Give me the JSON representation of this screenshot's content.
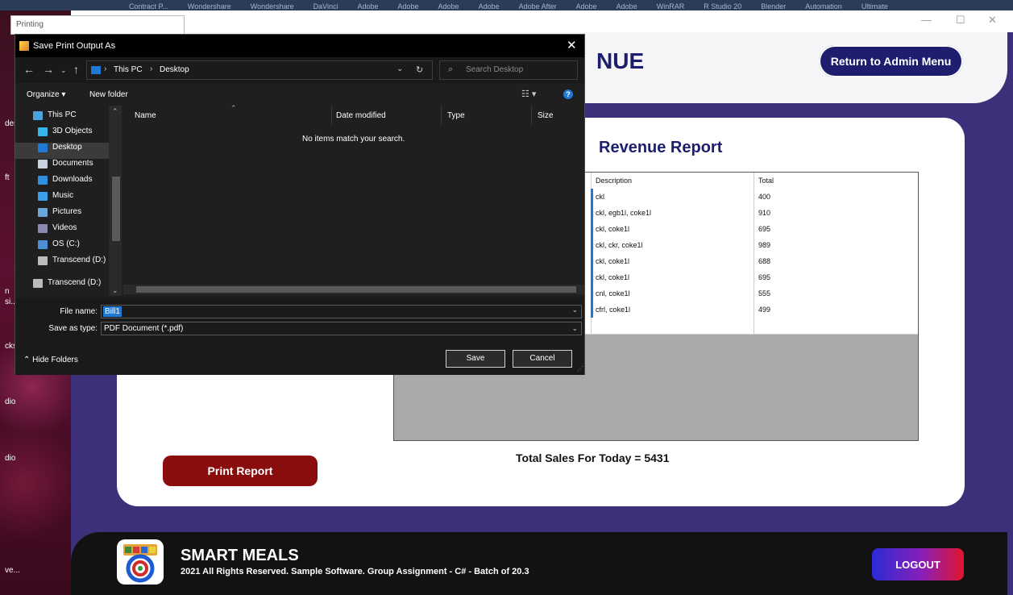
{
  "taskbar": {
    "items": [
      "Contract P...",
      "Wondershare",
      "Wondershare",
      "DaVinci",
      "Adobe",
      "Adobe",
      "Adobe",
      "Adobe",
      "Adobe After",
      "Adobe",
      "Adobe",
      "WinRAR",
      "R Studio 20",
      "Blender",
      "Automation",
      "Ultimate"
    ]
  },
  "desktop": {
    "labels": [
      "der",
      "ft",
      "n",
      "si...",
      "cks",
      "dio",
      "dio",
      "ve..."
    ]
  },
  "printing_window": {
    "title": "Printing"
  },
  "app": {
    "header_title": "NUE",
    "return_button": "Return to Admin Menu",
    "report_title": "Revenue Report",
    "grid": {
      "columns": [
        "Description",
        "Total"
      ],
      "rows": [
        {
          "description": "ckl",
          "total": "400"
        },
        {
          "description": "ckl, egb1l, coke1l",
          "total": "910"
        },
        {
          "description": "ckl, coke1l",
          "total": "695"
        },
        {
          "description": "ckl, ckr, coke1l",
          "total": "989"
        },
        {
          "description": "ckl, coke1l",
          "total": "688"
        },
        {
          "description": "ckl, coke1l",
          "total": "695"
        },
        {
          "description": "cnl, coke1l",
          "total": "555"
        },
        {
          "description": "cfrl, coke1l",
          "total": "499"
        },
        {
          "description": "",
          "total": ""
        }
      ]
    },
    "total_sales": "Total Sales For Today = 5431",
    "print_button": "Print Report",
    "footer": {
      "brand": "SMART MEALS",
      "copyright": "2021 All Rights Reserved.  Sample Software. Group Assignment - C# - Batch of 20.3",
      "logout_button": "LOGOUT"
    }
  },
  "save_dialog": {
    "title": "Save Print Output As",
    "breadcrumb": [
      "This PC",
      "Desktop"
    ],
    "search_placeholder": "Search Desktop",
    "organize": "Organize ▾",
    "new_folder": "New folder",
    "nav_tree": [
      "This PC",
      "3D Objects",
      "Desktop",
      "Documents",
      "Downloads",
      "Music",
      "Pictures",
      "Videos",
      "OS (C:)",
      "Transcend (D:)",
      "Transcend (D:)"
    ],
    "nav_tree_selected": "Desktop",
    "columns": [
      "Name",
      "Date modified",
      "Type",
      "Size"
    ],
    "empty_message": "No items match your search.",
    "file_name_label": "File name:",
    "file_name_value": "Bill1",
    "save_as_type_label": "Save as type:",
    "save_as_type_value": "PDF Document (*.pdf)",
    "hide_folders": "Hide Folders",
    "save_button": "Save",
    "cancel_button": "Cancel"
  }
}
